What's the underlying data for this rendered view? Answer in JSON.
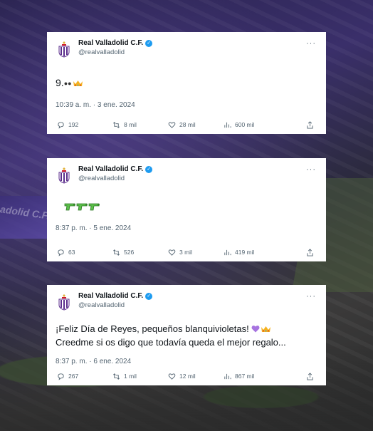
{
  "tweets": [
    {
      "author_name": "Real Valladolid C.F.",
      "handle": "@realvalladolid",
      "text": "9.",
      "emoji": [
        "eyes",
        "crown"
      ],
      "timestamp": "10:39 a. m. · 3 ene. 2024",
      "stats": {
        "replies": "192",
        "retweets": "8 mil",
        "likes": "28 mil",
        "views": "600 mil"
      }
    },
    {
      "author_name": "Real Valladolid C.F.",
      "handle": "@realvalladolid",
      "text": "",
      "emoji": [
        "water-pistol",
        "water-pistol",
        "water-pistol"
      ],
      "timestamp": "8:37 p. m. · 5 ene. 2024",
      "stats": {
        "replies": "63",
        "retweets": "526",
        "likes": "3 mil",
        "views": "419 mil"
      }
    },
    {
      "author_name": "Real Valladolid C.F.",
      "handle": "@realvalladolid",
      "text_line1": "¡Feliz Día de Reyes, pequeños blanquivioletas!",
      "text_line2": "Creedme si os digo que todavía queda el mejor regalo...",
      "emoji": [
        "purple-heart",
        "crown"
      ],
      "timestamp": "8:37 p. m. · 6 ene. 2024",
      "stats": {
        "replies": "267",
        "retweets": "1 mil",
        "likes": "12 mil",
        "views": "867 mil"
      }
    }
  ],
  "colors": {
    "brand_purple": "#5b2d8c",
    "verified_blue": "#1d9bf0",
    "text_secondary": "#536471"
  },
  "background_text": "adolid C.F."
}
